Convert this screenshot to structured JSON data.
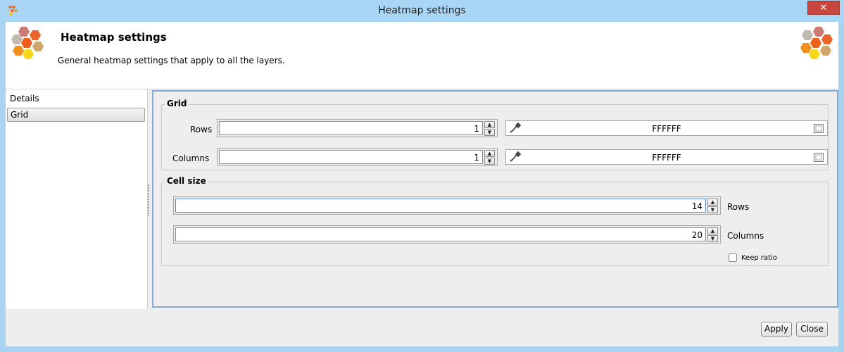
{
  "window": {
    "title": "Heatmap settings",
    "close_label": "✕"
  },
  "header": {
    "title": "Heatmap settings",
    "description": "General heatmap settings that apply to all the layers."
  },
  "nav": {
    "items": [
      {
        "label": "Details",
        "selected": false
      },
      {
        "label": "Grid",
        "selected": true
      }
    ]
  },
  "grid_group": {
    "title": "Grid",
    "rows_label": "Rows",
    "rows_value": "1",
    "rows_color": "FFFFFF",
    "columns_label": "Columns",
    "columns_value": "1",
    "columns_color": "FFFFFF"
  },
  "cell_size_group": {
    "title": "Cell size",
    "rows_value": "14",
    "rows_label": "Rows",
    "columns_value": "20",
    "columns_label": "Columns",
    "keep_ratio_label": "Keep ratio",
    "keep_ratio_checked": false
  },
  "buttons": {
    "apply": "Apply",
    "close": "Close"
  },
  "colors": {
    "title_bar": "#a9d6f5",
    "close_button": "#c7463f",
    "panel_border": "#84a9d4"
  },
  "icons": {
    "app": "heatmap-hexagons-icon",
    "color_picker": "eyedropper-icon",
    "color_swatch": "color-square-icon",
    "spin_up": "arrow-up-icon",
    "spin_down": "arrow-down-icon"
  }
}
